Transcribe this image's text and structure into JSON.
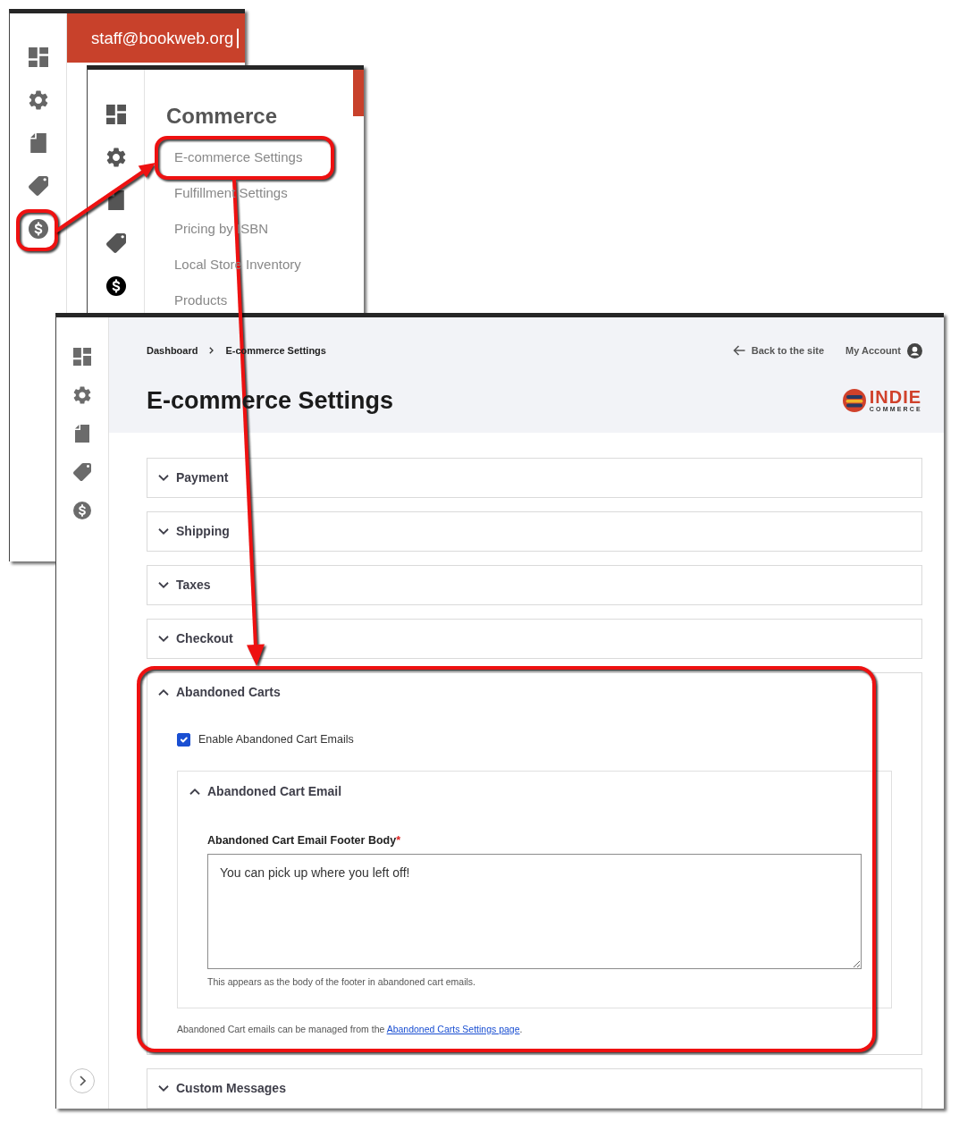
{
  "account_window": {
    "email": "staff@bookweb.org",
    "sidebar": [
      {
        "selected": false
      },
      {
        "selected": false
      },
      {
        "selected": false
      },
      {
        "selected": false
      },
      {
        "selected": false
      }
    ]
  },
  "menu_window": {
    "sidebar": [
      {
        "selected": false
      },
      {
        "selected": false
      },
      {
        "selected": false
      },
      {
        "selected": false
      },
      {
        "selected": true
      }
    ],
    "menu": {
      "heading": "Commerce",
      "items": [
        "E-commerce Settings",
        "Fulfillment Settings",
        "Pricing by ISBN",
        "Local Store Inventory",
        "Products"
      ]
    }
  },
  "settings_window": {
    "sidebar": [
      {
        "selected": false
      },
      {
        "selected": false
      },
      {
        "selected": false
      },
      {
        "selected": false
      },
      {
        "selected": false
      }
    ],
    "breadcrumb": [
      "Dashboard",
      "E-commerce Settings"
    ],
    "header_links": [
      {
        "kind": "back",
        "label": "Back to the site"
      },
      {
        "kind": "account",
        "label": "My Account"
      }
    ],
    "title": "E-commerce Settings",
    "logo": {
      "name": "INDIE",
      "tagline": "COMMERCE"
    },
    "sections": [
      {
        "title": "Payment",
        "expanded": false
      },
      {
        "title": "Shipping",
        "expanded": false
      },
      {
        "title": "Taxes",
        "expanded": false
      },
      {
        "title": "Checkout",
        "expanded": false
      },
      {
        "title": "Abandoned Carts",
        "expanded": true,
        "checkbox": {
          "label": "Enable Abandoned Cart Emails",
          "checked": true
        },
        "subsection": {
          "title": "Abandoned Cart Email",
          "expanded": true,
          "field": {
            "label": "Abandoned Cart Email Footer Body",
            "required_mark": "*",
            "value": "You can pick up where you left off!",
            "help": "This appears as the body of the footer in abandoned cart emails."
          }
        },
        "note": {
          "text_before": "Abandoned Cart emails can be managed from the ",
          "link": "Abandoned Carts Settings page",
          "text_after": "."
        }
      },
      {
        "title": "Custom Messages",
        "expanded": false
      }
    ]
  }
}
